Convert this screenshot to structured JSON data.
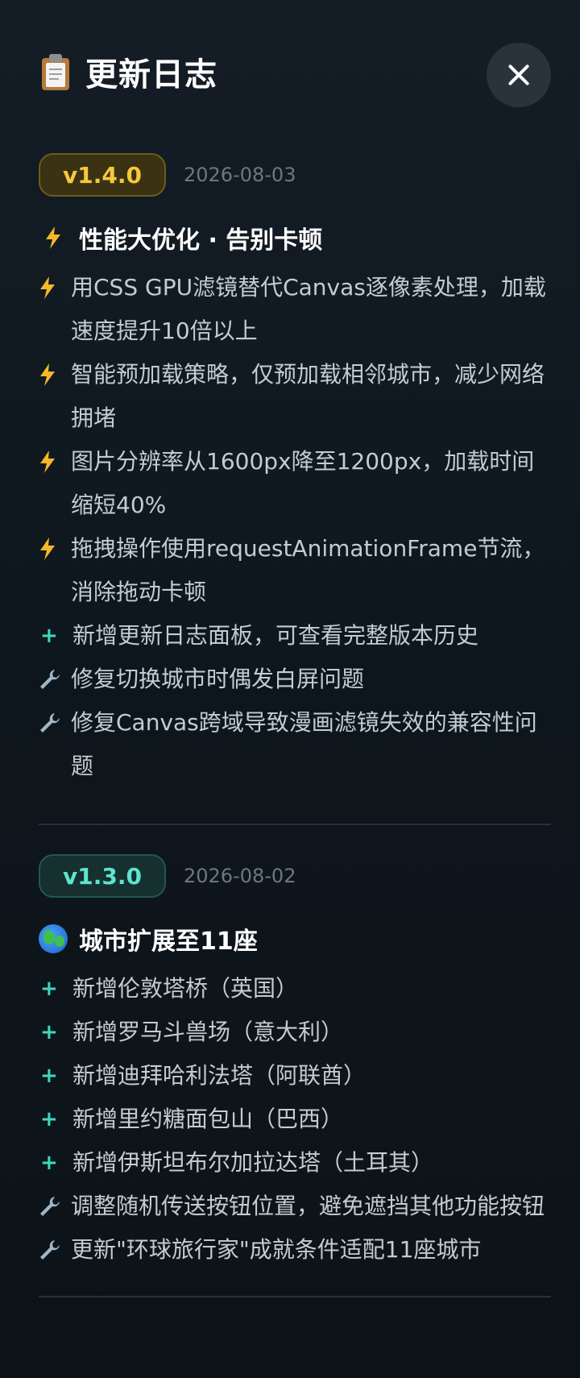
{
  "header": {
    "title": "更新日志",
    "title_icon": "clipboard-icon",
    "close_icon": "close-icon"
  },
  "versions": [
    {
      "version": "v1.4.0",
      "date": "2026-08-03",
      "badge_color": "#f6c83a",
      "title_icon": "lightning-icon",
      "title": "性能大优化 · 告别卡顿",
      "items": [
        {
          "icon": "lightning-icon",
          "text": "用CSS GPU滤镜替代Canvas逐像素处理，加载速度提升10倍以上"
        },
        {
          "icon": "lightning-icon",
          "text": "智能预加载策略，仅预加载相邻城市，减少网络拥堵"
        },
        {
          "icon": "lightning-icon",
          "text": "图片分辨率从1600px降至1200px，加载时间缩短40%"
        },
        {
          "icon": "lightning-icon",
          "text": "拖拽操作使用requestAnimationFrame节流，消除拖动卡顿"
        },
        {
          "icon": "plus-icon",
          "text": "新增更新日志面板，可查看完整版本历史"
        },
        {
          "icon": "wrench-icon",
          "text": "修复切换城市时偶发白屏问题"
        },
        {
          "icon": "wrench-icon",
          "text": "修复Canvas跨域导致漫画滤镜失效的兼容性问题"
        }
      ]
    },
    {
      "version": "v1.3.0",
      "date": "2026-08-02",
      "badge_color": "#5fe3cf",
      "title_icon": "globe-icon",
      "title": "城市扩展至11座",
      "items": [
        {
          "icon": "plus-icon",
          "text": "新增伦敦塔桥（英国）"
        },
        {
          "icon": "plus-icon",
          "text": "新增罗马斗兽场（意大利）"
        },
        {
          "icon": "plus-icon",
          "text": "新增迪拜哈利法塔（阿联酋）"
        },
        {
          "icon": "plus-icon",
          "text": "新增里约糖面包山（巴西）"
        },
        {
          "icon": "plus-icon",
          "text": "新增伊斯坦布尔加拉达塔（土耳其）"
        },
        {
          "icon": "wrench-icon",
          "text": "调整随机传送按钮位置，避免遮挡其他功能按钮"
        },
        {
          "icon": "wrench-icon",
          "text": "更新\"环球旅行家\"成就条件适配11座城市"
        }
      ]
    }
  ],
  "colors": {
    "background": "#0f1820",
    "gold_badge": "#f6c83a",
    "teal_badge": "#5fe3cf",
    "plus": "#3fd8bf",
    "bolt": "#f5b72a"
  }
}
